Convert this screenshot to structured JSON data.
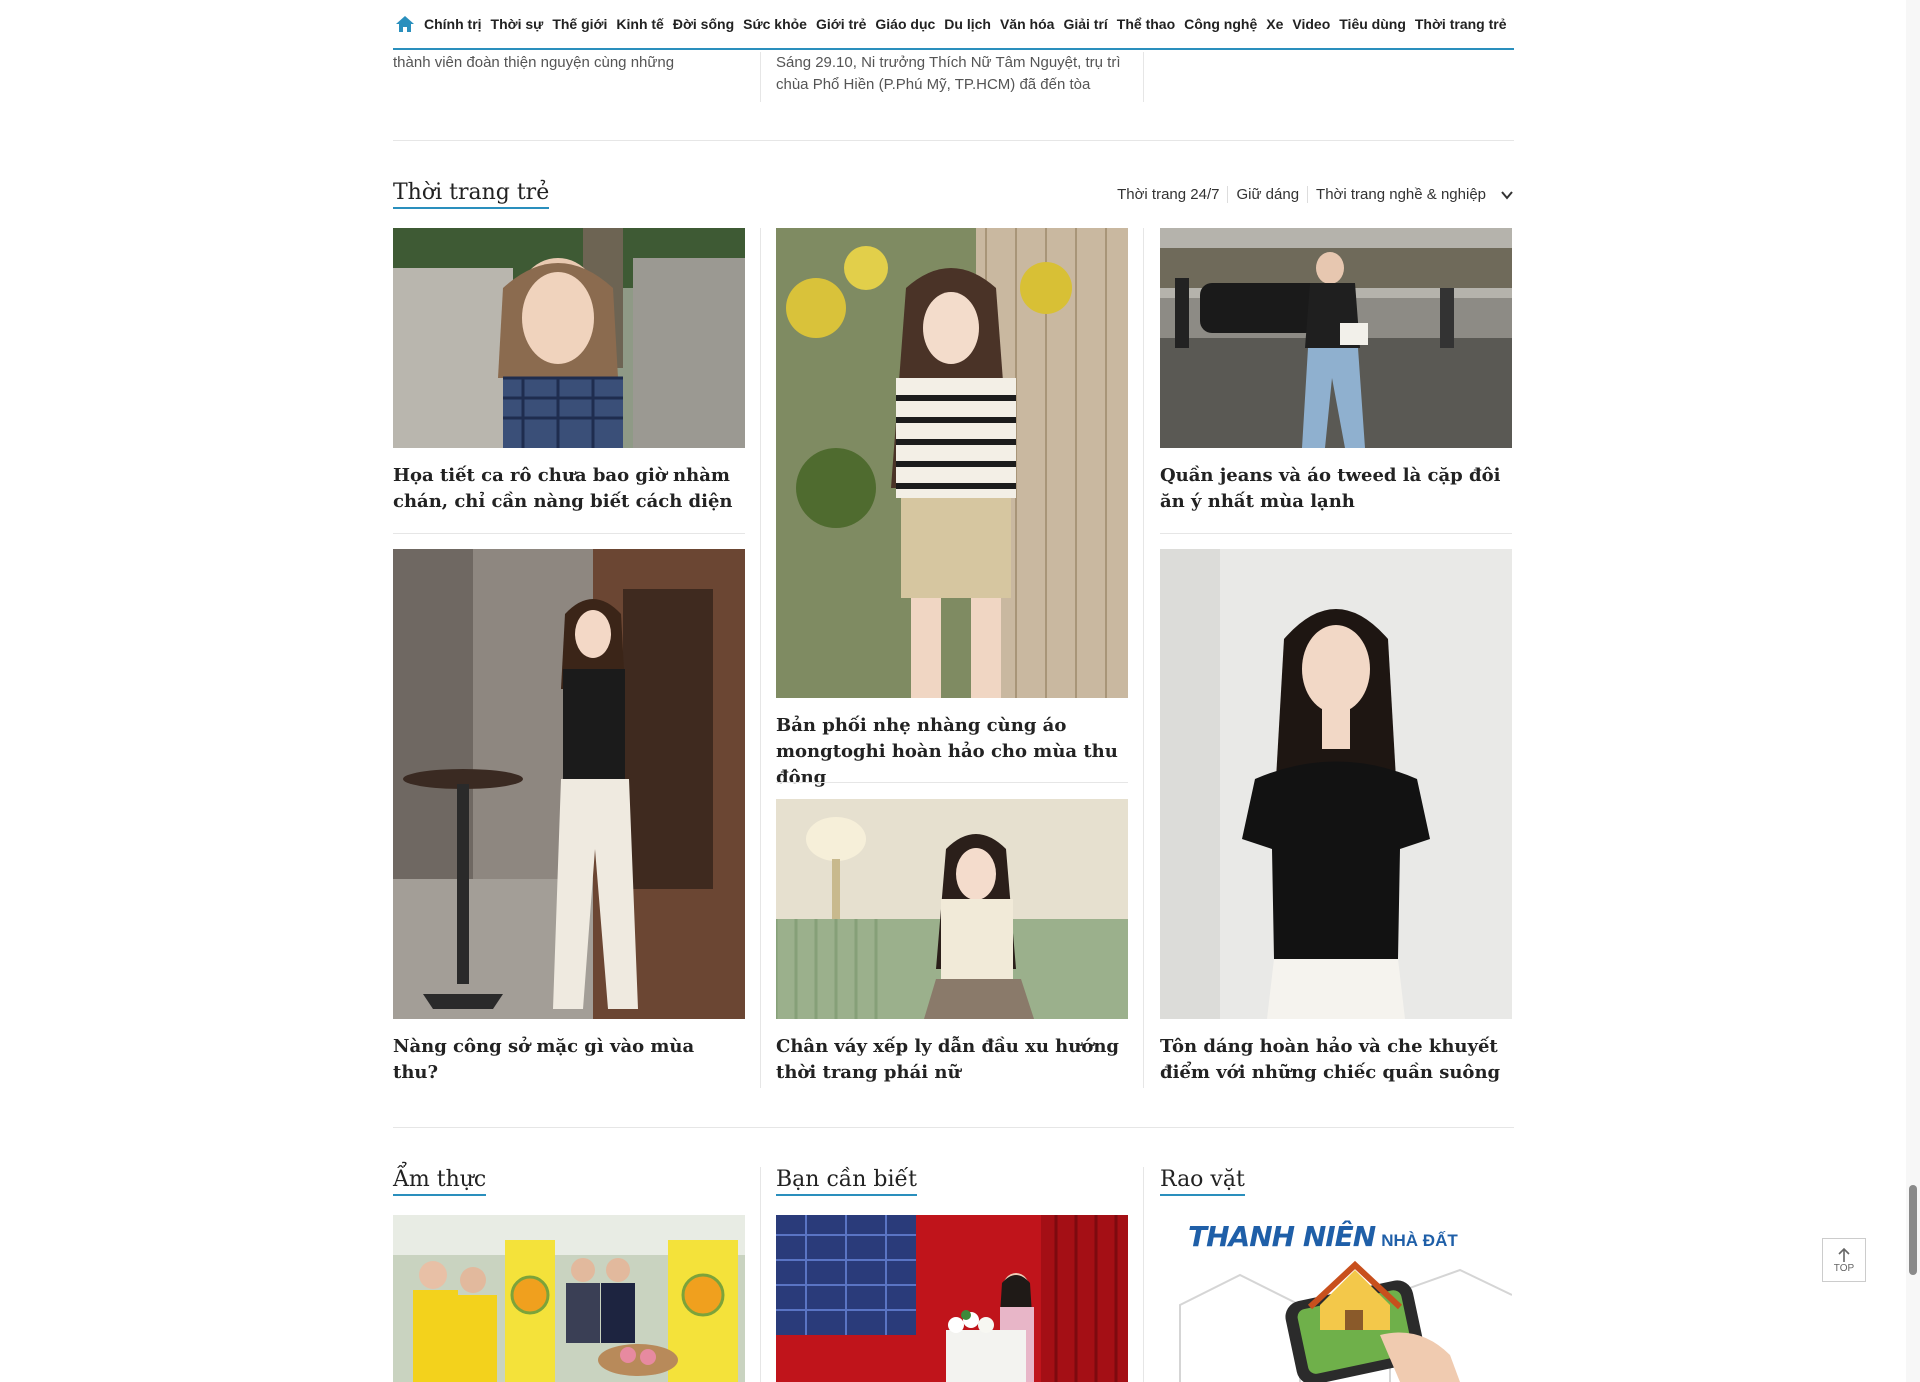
{
  "nav": {
    "items": [
      "Chính trị",
      "Thời sự",
      "Thế giới",
      "Kinh tế",
      "Đời sống",
      "Sức khỏe",
      "Giới trẻ",
      "Giáo dục",
      "Du lịch",
      "Văn hóa",
      "Giải trí",
      "Thể thao",
      "Công nghệ",
      "Xe",
      "Video",
      "Tiêu dùng",
      "Thời trang trẻ"
    ],
    "accent": "#2a8fbd"
  },
  "previous": {
    "col1_text": "thành viên đoàn thiện nguyện cùng những",
    "col2_text": "Sáng 29.10, Ni trưởng Thích Nữ Tâm Nguyệt, trụ trì chùa Phổ Hiền (P.Phú Mỹ, TP.HCM) đã đến tòa"
  },
  "fashion": {
    "title": "Thời trang trẻ",
    "subcategories": [
      "Thời trang 24/7",
      "Giữ dáng",
      "Thời trang nghề & nghiệp"
    ],
    "articles": [
      {
        "title": "Họa tiết ca rô chưa bao giờ nhàm chán, chỉ cần nàng biết cách diện"
      },
      {
        "title": "Bản phối nhẹ nhàng cùng áo mongtoghi hoàn hảo cho mùa thu đông"
      },
      {
        "title": "Quần jeans và áo tweed là cặp đôi ăn ý nhất mùa lạnh"
      },
      {
        "title": "Nàng công sở mặc gì vào mùa thu?"
      },
      {
        "title": "Chân váy xếp ly dẫn đầu xu hướng thời trang phái nữ"
      },
      {
        "title": "Tôn dáng hoàn hảo và che khuyết điểm với những chiếc quần suông"
      }
    ]
  },
  "bottom_sections": {
    "food": {
      "title": "Ẩm thực"
    },
    "know": {
      "title": "Bạn cần biết"
    },
    "classified": {
      "title": "Rao vặt",
      "ad_brand": "THANH NIÊN",
      "ad_sub": "NHÀ ĐẤT"
    }
  },
  "back_to_top": {
    "label": "TOP"
  }
}
